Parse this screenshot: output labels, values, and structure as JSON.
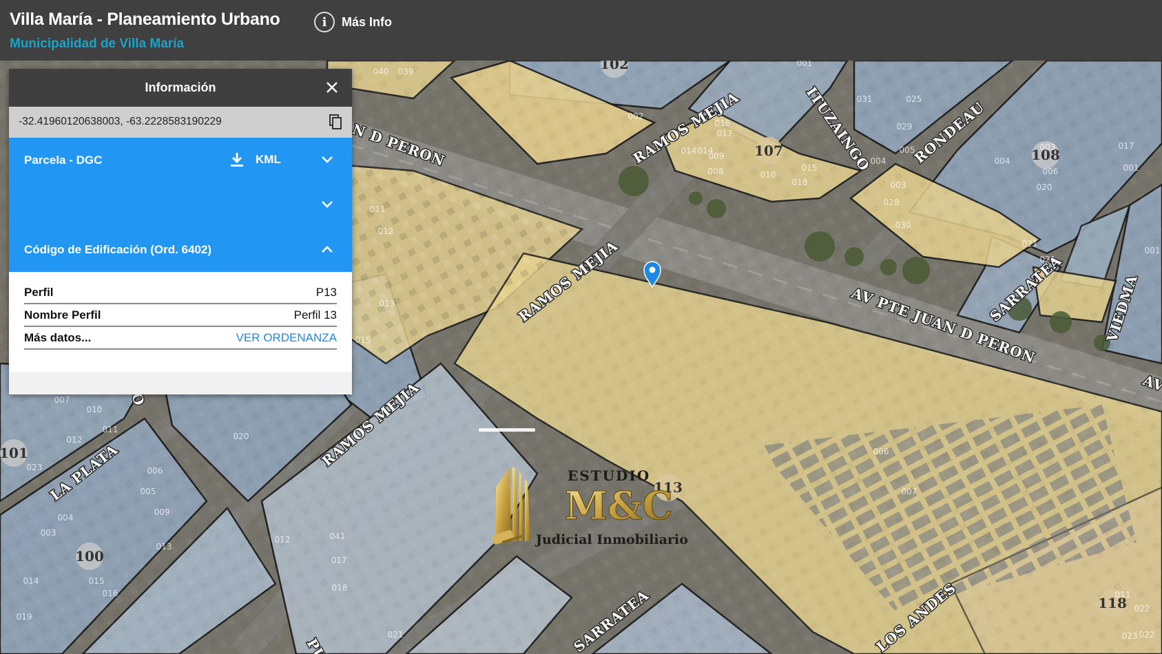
{
  "header": {
    "title": "Villa María - Planeamiento Urbano",
    "subtitle": "Municipalidad de Villa María",
    "info_label": "Más Info"
  },
  "panel": {
    "title": "Información",
    "coordinates": "-32.41960120638003, -63.2228583190229",
    "sections": [
      {
        "label": "Parcela - DGC",
        "download_label": "KML",
        "expanded": false
      },
      {
        "label": "",
        "expanded": false
      },
      {
        "label": "Código de Edificación (Ord. 6402)",
        "expanded": true
      }
    ],
    "rows": [
      {
        "key": "Perfil",
        "value": "P13"
      },
      {
        "key": "Nombre Perfil",
        "value": "Perfil 13"
      },
      {
        "key": "Más datos...",
        "value": "VER ORDENANZA"
      }
    ]
  },
  "map": {
    "streets": [
      "N D PERON",
      "RAMOS MEJIA",
      "ITUZAINGO",
      "RONDEAU",
      "RAMOS MEJIA",
      "AV PTE JUAN D PERON",
      "SARRATEA",
      "VIEDMA",
      "AV",
      "RAMOS MEJIA",
      "LA PLATA",
      "CO",
      "SARRATEA",
      "LOS ANDES",
      "PUE"
    ],
    "block_numbers": [
      "102",
      "107",
      "108",
      "101",
      "100",
      "113",
      "118"
    ],
    "parcel_numbers": [
      "040",
      "039",
      "002",
      "001",
      "011",
      "012",
      "013",
      "015",
      "020",
      "007",
      "010",
      "011",
      "012",
      "003",
      "004",
      "005",
      "006",
      "009",
      "013",
      "023",
      "019",
      "017",
      "016",
      "014",
      "015",
      "041",
      "018",
      "021",
      "001",
      "022",
      "007",
      "006",
      "018",
      "020",
      "021",
      "017",
      "014",
      "008",
      "009",
      "010",
      "015",
      "016",
      "017",
      "025",
      "029",
      "028",
      "030",
      "031",
      "004",
      "003",
      "005",
      "006",
      "001",
      "014",
      "011",
      "022",
      "023",
      "004",
      "003",
      "012",
      "021"
    ],
    "marker_color": "#1e88e5",
    "parcel_color": "#e3cf8e",
    "block_color": "#8fa3b8"
  },
  "watermark": {
    "line1": "ESTUDIO",
    "line2": "M&C",
    "line3": "Judicial Inmobiliario"
  }
}
